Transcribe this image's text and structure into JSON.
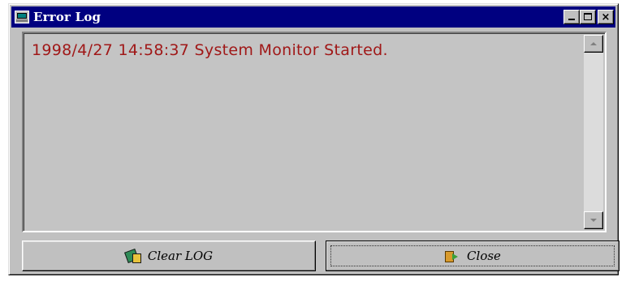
{
  "window": {
    "title": "Error Log"
  },
  "title_buttons": {
    "minimize_label": "",
    "maximize_label": "",
    "close_label": "×"
  },
  "log": {
    "entries": [
      "1998/4/27 14:58:37 System Monitor Started."
    ],
    "text_color": "#a01818"
  },
  "buttons": {
    "clear_label": "Clear LOG",
    "clear_icon": "eraser-icon",
    "close_label": "Close",
    "close_icon": "door-exit-icon"
  },
  "colors": {
    "titlebar": "#000080",
    "face": "#c0c0c0"
  }
}
